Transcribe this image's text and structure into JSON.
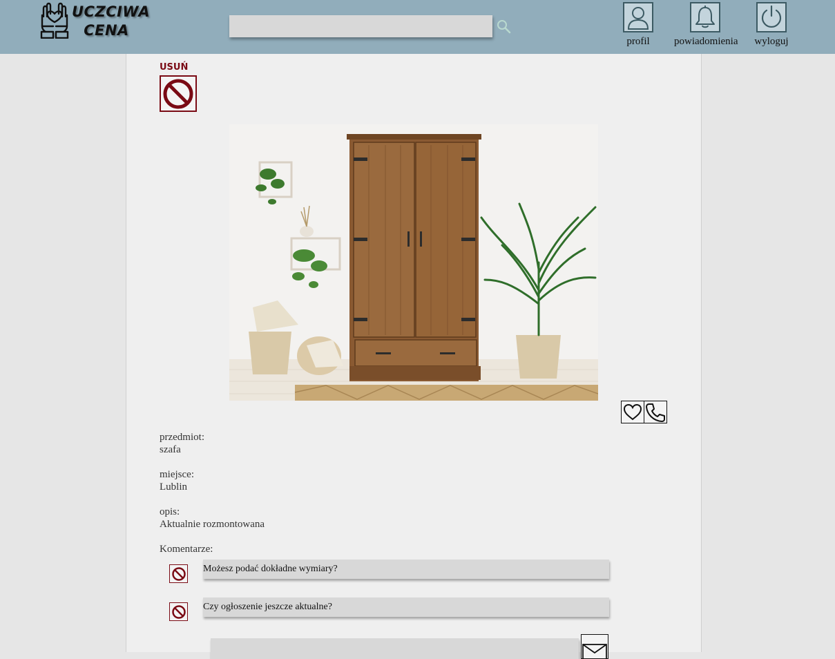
{
  "header": {
    "logo": {
      "line1": "UCZCIWA",
      "line2": "CENA",
      "icon": "hands-heart-icon"
    },
    "search": {
      "placeholder": "",
      "value": "",
      "icon": "search-icon"
    },
    "nav": [
      {
        "label": "profil",
        "icon": "user-icon"
      },
      {
        "label": "powiadomienia",
        "icon": "bell-icon"
      },
      {
        "label": "wyloguj",
        "icon": "power-icon"
      }
    ],
    "color": "#91adbb"
  },
  "listing": {
    "delete_label": "USUŃ",
    "photo": {
      "subject": "wooden wardrobe with plants"
    },
    "actions": [
      {
        "icon": "heart-icon"
      },
      {
        "icon": "phone-icon"
      }
    ],
    "fields": {
      "item": {
        "label": "przedmiot:",
        "value": "szafa"
      },
      "place": {
        "label": "miejsce:",
        "value": "Lublin"
      },
      "description": {
        "label": "opis:",
        "value": "Aktualnie rozmontowana"
      }
    },
    "comments_label": "Komentarze:",
    "comments": [
      {
        "text": "Możesz podać dokładne wymiary?"
      },
      {
        "text": "Czy ogłoszenie jeszcze aktualne?"
      }
    ],
    "new_comment": {
      "placeholder": "",
      "value": ""
    },
    "accent_color": "#7a0a14"
  }
}
